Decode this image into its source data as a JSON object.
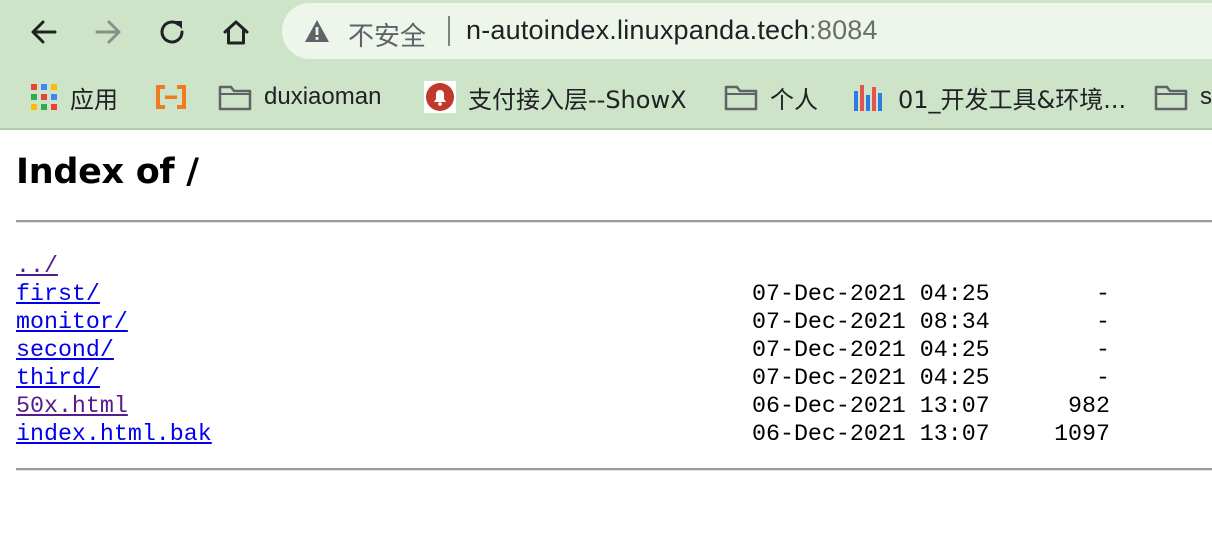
{
  "browser": {
    "security_label": "不安全",
    "url_host": "n-autoindex.linuxpanda.tech",
    "url_port": ":8084",
    "icons": {
      "back": "arrow-left-icon",
      "forward": "arrow-right-icon",
      "reload": "reload-icon",
      "home": "home-icon",
      "security": "warning-triangle-icon"
    },
    "bookmarks": [
      {
        "label": "应用",
        "icon": "apps-grid-icon"
      },
      {
        "label": "",
        "icon": "bracket-logo-icon"
      },
      {
        "label": "duxiaoman",
        "icon": "folder-icon"
      },
      {
        "label": "支付接入层--ShowX",
        "icon": "bell-logo-icon"
      },
      {
        "label": "个人",
        "icon": "folder-icon"
      },
      {
        "label": "01_开发工具&环境...",
        "icon": "wiki-logo-icon"
      },
      {
        "label": "s",
        "icon": "folder-icon"
      }
    ]
  },
  "page": {
    "title": "Index of /",
    "entries": [
      {
        "name": "../",
        "date": "",
        "size": "",
        "visited": true
      },
      {
        "name": "first/",
        "date": "07-Dec-2021 04:25",
        "size": "-",
        "visited": false
      },
      {
        "name": "monitor/",
        "date": "07-Dec-2021 08:34",
        "size": "-",
        "visited": false
      },
      {
        "name": "second/",
        "date": "07-Dec-2021 04:25",
        "size": "-",
        "visited": false
      },
      {
        "name": "third/",
        "date": "07-Dec-2021 04:25",
        "size": "-",
        "visited": false
      },
      {
        "name": "50x.html",
        "date": "06-Dec-2021 13:07",
        "size": "982",
        "visited": true
      },
      {
        "name": "index.html.bak",
        "date": "06-Dec-2021 13:07",
        "size": "1097",
        "visited": false
      }
    ]
  },
  "colors": {
    "chrome_bg": "#cde4c9",
    "link": "#0000ee",
    "visited_link": "#551a8b"
  }
}
